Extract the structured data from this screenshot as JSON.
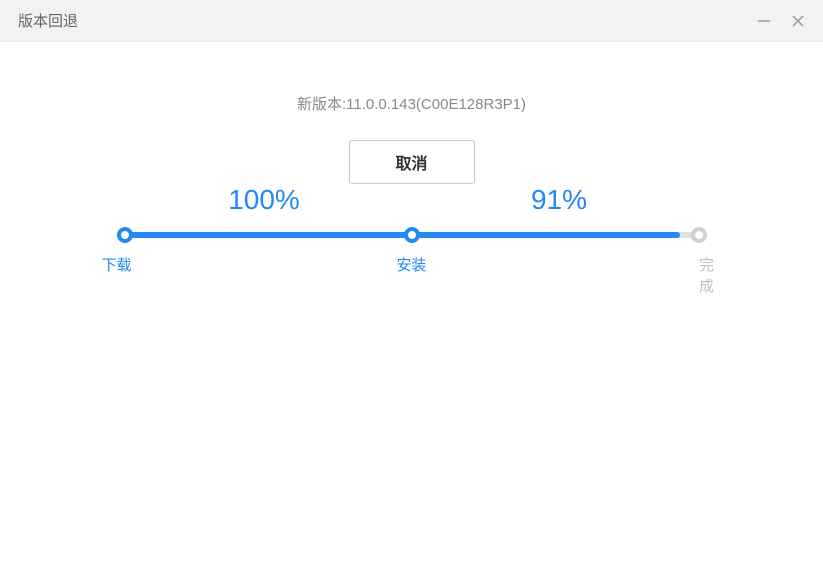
{
  "header": {
    "title": "版本回退"
  },
  "progress": {
    "steps": [
      {
        "label": "下载",
        "percent": "100%",
        "active": true
      },
      {
        "label": "安装",
        "percent": "91%",
        "active": true
      },
      {
        "label": "完成",
        "percent": "",
        "active": false
      }
    ],
    "segments": [
      {
        "fill": 100
      },
      {
        "fill": 91
      }
    ]
  },
  "version": "新版本:11.0.0.143(C00E128R3P1)",
  "buttons": {
    "cancel": "取消"
  }
}
